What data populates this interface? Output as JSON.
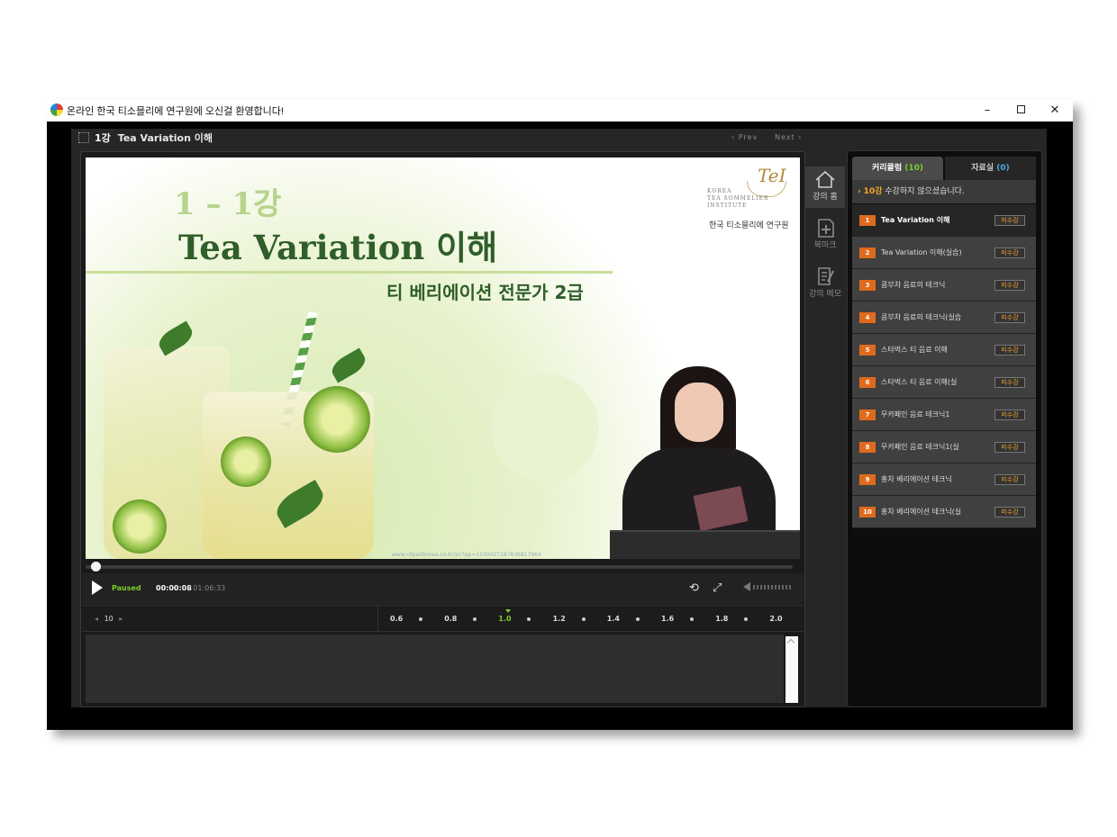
{
  "window": {
    "title": "온라인 한국 티소믈리에 연구원에 오신걸 환영합니다!",
    "minimize": "–",
    "close": "✕"
  },
  "header": {
    "lesson_num": "1강",
    "lesson_title": "Tea Variation 이해",
    "prev_label": "‹ Prev",
    "next_label": "Next ›"
  },
  "slide": {
    "number": "1 – 1강",
    "title": "Tea Variation  이해",
    "subtitle": "티 베리에이션 전문가 2급",
    "logo_mark": "TeI",
    "logo_en_1": "KOREA",
    "logo_en_2": "TEA SOMMELIER",
    "logo_en_3": "INSTITUTE",
    "logo_ko": "한국 티소믈리에 연구원",
    "watermark": "www.clipartkorea.co.kr/pc?pp=1100027187836817964"
  },
  "player": {
    "status": "Paused",
    "current_time": "00:00:08",
    "total_time": "/ 01:06:33",
    "progress_fraction": 0.002,
    "page_value": "10",
    "speeds": [
      "0.6",
      "0.8",
      "1.0",
      "1.2",
      "1.4",
      "1.6",
      "1.8",
      "2.0"
    ],
    "active_speed": "1.0"
  },
  "sidetools": {
    "home_label": "강의 홈",
    "bookmark_label": "북마크",
    "memo_label": "강의 메모"
  },
  "panel": {
    "tab_curriculum": "커리큘럼",
    "tab_curriculum_count": "(10)",
    "tab_materials": "자료실",
    "tab_materials_count": "(0)",
    "notice_prefix": "›",
    "notice_count": "10강",
    "notice_text": " 수강하지 않으셨습니다.",
    "lessons": [
      {
        "num": "1",
        "title": "Tea Variation 이해",
        "badge": "미수강"
      },
      {
        "num": "2",
        "title": "Tea Variation 이해(실습)",
        "badge": "미수강"
      },
      {
        "num": "3",
        "title": "콤부차 음료의 테크닉",
        "badge": "미수강"
      },
      {
        "num": "4",
        "title": "콤부차 음료의 테크닉(실습",
        "badge": "미수강"
      },
      {
        "num": "5",
        "title": "스타벅스 티 음료 이해",
        "badge": "미수강"
      },
      {
        "num": "6",
        "title": "스타벅스 티 음료 이해(실",
        "badge": "미수강"
      },
      {
        "num": "7",
        "title": "무카페인 음료 테크닉1",
        "badge": "미수강"
      },
      {
        "num": "8",
        "title": "무카페인 음료 테크닉1(실",
        "badge": "미수강"
      },
      {
        "num": "9",
        "title": "홍차 베리에이션 테크닉",
        "badge": "미수강"
      },
      {
        "num": "10",
        "title": "홍차 베리에이션 테크닉(실",
        "badge": "미수강"
      }
    ]
  },
  "colors": {
    "accent_green": "#7ccc2b",
    "accent_orange": "#e06a1c",
    "badge_text": "#f4a72a",
    "slide_green": "#2f5e2a"
  }
}
